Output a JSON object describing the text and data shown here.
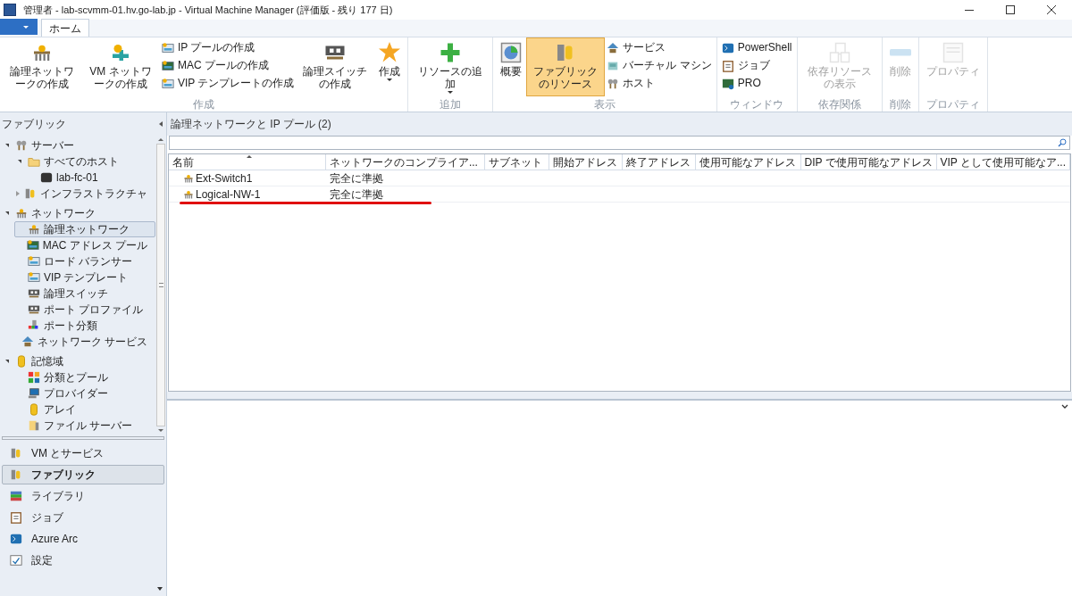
{
  "window": {
    "title": "管理者 - lab-scvmm-01.hv.go-lab.jp - Virtual Machine Manager (評価版 - 残り 177 日)"
  },
  "ribbon": {
    "tabs": [
      {
        "label": "ホーム",
        "selected": true
      }
    ],
    "groups": [
      {
        "label": "作成",
        "items": [
          {
            "kind": "large",
            "label": "論理ネットワークの作成",
            "disabled": false,
            "selected": false,
            "dropdown": false
          },
          {
            "kind": "large",
            "label": "VM ネットワークの作成",
            "disabled": false,
            "selected": false,
            "dropdown": false
          },
          {
            "kind": "stack",
            "items": [
              {
                "label": "IP プールの作成"
              },
              {
                "label": "MAC プールの作成"
              },
              {
                "label": "VIP テンプレートの作成"
              }
            ]
          },
          {
            "kind": "large",
            "label": "論理スイッチの作成",
            "disabled": false,
            "selected": false,
            "dropdown": false
          },
          {
            "kind": "large",
            "label": "作成",
            "disabled": false,
            "selected": false,
            "dropdown": true
          }
        ]
      },
      {
        "label": "追加",
        "items": [
          {
            "kind": "large",
            "label": "リソースの追加",
            "disabled": false,
            "selected": false,
            "dropdown": true
          }
        ]
      },
      {
        "label": "表示",
        "items": [
          {
            "kind": "large",
            "label": "概要",
            "disabled": false,
            "selected": false,
            "dropdown": false
          },
          {
            "kind": "large",
            "label": "ファブリックのリソース",
            "disabled": false,
            "selected": true,
            "dropdown": false
          },
          {
            "kind": "stack",
            "items": [
              {
                "label": "サービス"
              },
              {
                "label": "バーチャル マシン"
              },
              {
                "label": "ホスト"
              }
            ]
          }
        ]
      },
      {
        "label": "ウィンドウ",
        "items": [
          {
            "kind": "stack",
            "items": [
              {
                "label": "PowerShell"
              },
              {
                "label": "ジョブ"
              },
              {
                "label": "PRO"
              }
            ]
          }
        ]
      },
      {
        "label": "依存関係",
        "items": [
          {
            "kind": "large",
            "label": "依存リソースの表示",
            "disabled": true,
            "selected": false,
            "dropdown": false
          }
        ]
      },
      {
        "label": "削除",
        "items": [
          {
            "kind": "large",
            "label": "削除",
            "disabled": true,
            "selected": false,
            "dropdown": false
          }
        ]
      },
      {
        "label": "プロパティ",
        "items": [
          {
            "kind": "large",
            "label": "プロパティ",
            "disabled": true,
            "selected": false,
            "dropdown": false
          }
        ]
      }
    ]
  },
  "sidebar": {
    "title": "ファブリック",
    "tree": [
      {
        "label": "サーバー",
        "expanded": true,
        "selected": false,
        "children": [
          {
            "label": "すべてのホスト",
            "expanded": true,
            "selected": false,
            "children": [
              {
                "label": "lab-fc-01",
                "selected": false
              }
            ]
          },
          {
            "label": "インフラストラクチャ",
            "expanded": false,
            "selected": false
          }
        ]
      },
      {
        "label": "ネットワーク",
        "expanded": true,
        "selected": false,
        "children": [
          {
            "label": "論理ネットワーク",
            "selected": true
          },
          {
            "label": "MAC アドレス プール",
            "selected": false
          },
          {
            "label": "ロード バランサー",
            "selected": false
          },
          {
            "label": "VIP テンプレート",
            "selected": false
          },
          {
            "label": "論理スイッチ",
            "selected": false
          },
          {
            "label": "ポート プロファイル",
            "selected": false
          },
          {
            "label": "ポート分類",
            "selected": false
          },
          {
            "label": "ネットワーク サービス",
            "selected": false
          }
        ]
      },
      {
        "label": "記憶域",
        "expanded": true,
        "selected": false,
        "children": [
          {
            "label": "分類とプール",
            "selected": false
          },
          {
            "label": "プロバイダー",
            "selected": false
          },
          {
            "label": "アレイ",
            "selected": false
          },
          {
            "label": "ファイル サーバー",
            "selected": false
          }
        ]
      }
    ],
    "nav": [
      {
        "label": "VM とサービス",
        "selected": false
      },
      {
        "label": "ファブリック",
        "selected": true
      },
      {
        "label": "ライブラリ",
        "selected": false
      },
      {
        "label": "ジョブ",
        "selected": false
      },
      {
        "label": "Azure Arc",
        "selected": false
      },
      {
        "label": "設定",
        "selected": false
      }
    ]
  },
  "main": {
    "title": "論理ネットワークと IP プール (2)",
    "table": {
      "columns": [
        {
          "label": "名前",
          "sorted": true
        },
        {
          "label": "ネットワークのコンプライア...",
          "sorted": false
        },
        {
          "label": "サブネット",
          "sorted": false
        },
        {
          "label": "開始アドレス",
          "sorted": false
        },
        {
          "label": "終了アドレス",
          "sorted": false
        },
        {
          "label": "使用可能なアドレス",
          "sorted": false
        },
        {
          "label": "DIP で使用可能なアドレス",
          "sorted": false
        },
        {
          "label": "VIP として使用可能なア...",
          "sorted": false
        }
      ],
      "rows": [
        {
          "name": "Ext-Switch1",
          "compliance": "完全に準拠",
          "underlined": false
        },
        {
          "name": "Logical-NW-1",
          "compliance": "完全に準拠",
          "underlined": true
        }
      ]
    }
  }
}
